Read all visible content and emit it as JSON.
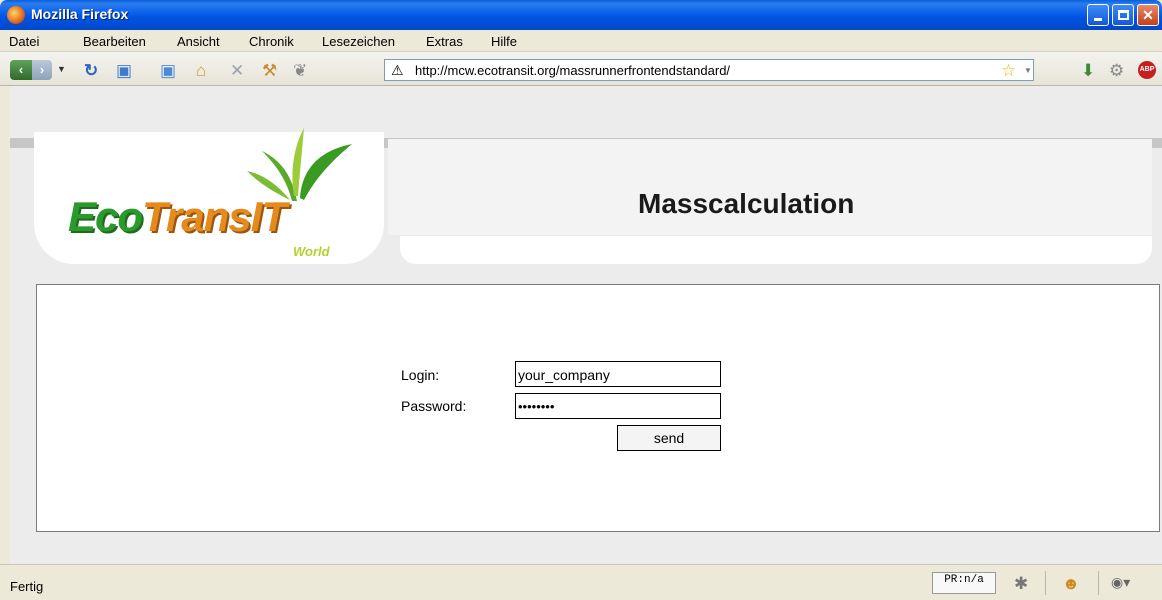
{
  "window": {
    "title": "Mozilla Firefox"
  },
  "menu": {
    "items": [
      "Datei",
      "Bearbeiten",
      "Ansicht",
      "Chronik",
      "Lesezeichen",
      "Extras",
      "Hilfe"
    ]
  },
  "toolbar": {
    "url": "http://mcw.ecotransit.org/massrunnerfrontendstandard/"
  },
  "page": {
    "logo": {
      "eco": "Eco",
      "trans": "TransIT",
      "world": "World"
    },
    "title": "Masscalculation",
    "form": {
      "login_label": "Login:",
      "login_value": "your_company",
      "password_label": "Password:",
      "password_value": "••••••••",
      "send_label": "send"
    }
  },
  "status": {
    "text": "Fertig",
    "pagerank": "PR:n/a"
  },
  "colors": {
    "titlebar": "#0055e5",
    "eco_green": "#2a9a2a",
    "transit_orange": "#e58a1c"
  }
}
